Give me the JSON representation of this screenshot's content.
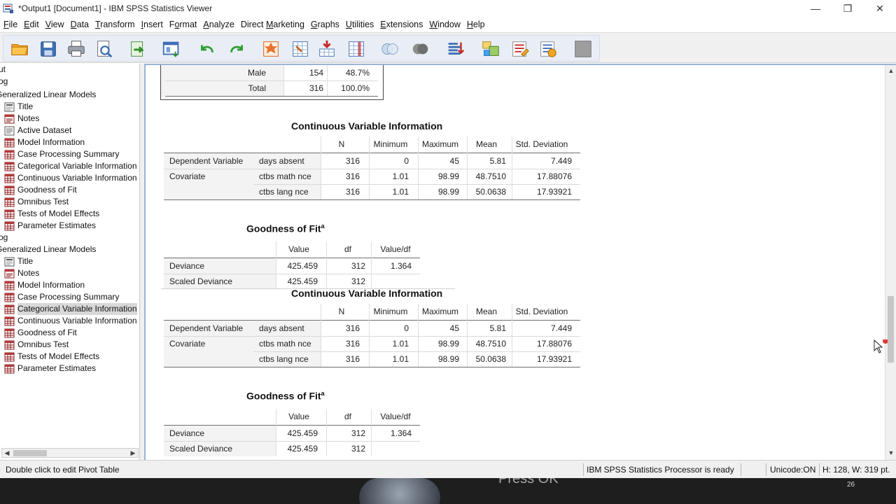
{
  "window": {
    "title": "*Output1 [Document1] - IBM SPSS Statistics Viewer",
    "minimize": "—",
    "restore": "❐",
    "close": "✕"
  },
  "menu": [
    {
      "label": "File",
      "u": "F",
      "rest": "ile"
    },
    {
      "label": "Edit",
      "u": "E",
      "rest": "dit"
    },
    {
      "label": "View",
      "u": "V",
      "rest": "iew"
    },
    {
      "label": "Data",
      "u": "D",
      "rest": "ata"
    },
    {
      "label": "Transform",
      "u": "T",
      "rest": "ransform"
    },
    {
      "label": "Insert",
      "u": "I",
      "rest": "nsert"
    },
    {
      "label": "Format",
      "pre": "F",
      "u": "o",
      "rest": "rmat"
    },
    {
      "label": "Analyze",
      "u": "A",
      "rest": "nalyze"
    },
    {
      "label": "Direct Marketing",
      "pre": "Direct ",
      "u": "M",
      "rest": "arketing"
    },
    {
      "label": "Graphs",
      "u": "G",
      "rest": "raphs"
    },
    {
      "label": "Utilities",
      "u": "U",
      "rest": "tilities"
    },
    {
      "label": "Extensions",
      "u": "E",
      "rest": "xtensions"
    },
    {
      "label": "Window",
      "u": "W",
      "rest": "indow"
    },
    {
      "label": "Help",
      "u": "H",
      "rest": "elp"
    }
  ],
  "toolbar_icons": [
    "open-folder-icon",
    "save-icon",
    "print-icon",
    "print-preview-icon",
    "export-icon",
    "recall-dialog-icon",
    "undo-icon",
    "redo-icon",
    "goto-case-icon",
    "goto-variable-icon",
    "insert-cases-icon",
    "insert-variable-icon",
    "split-file-icon",
    "select-cases-icon",
    "weight-cases-icon",
    "value-labels-icon",
    "use-sets-icon",
    "show-variables-icon",
    "spell-check-icon",
    "disabled-icon"
  ],
  "outline": [
    {
      "label": "ut",
      "icon": ""
    },
    {
      "label": "og",
      "icon": ""
    },
    {
      "label": "Generalized Linear Models",
      "icon": ""
    },
    {
      "label": "Title",
      "icon": "title-icon"
    },
    {
      "label": "Notes",
      "icon": "notes-icon"
    },
    {
      "label": "Active Dataset",
      "icon": "log-icon"
    },
    {
      "label": "Model Information",
      "icon": "table-icon"
    },
    {
      "label": "Case Processing Summary",
      "icon": "table-icon"
    },
    {
      "label": "Categorical Variable Information",
      "icon": "table-icon"
    },
    {
      "label": "Continuous Variable Information",
      "icon": "table-icon"
    },
    {
      "label": "Goodness of Fit",
      "icon": "table-icon"
    },
    {
      "label": "Omnibus Test",
      "icon": "table-icon"
    },
    {
      "label": "Tests of Model Effects",
      "icon": "table-icon"
    },
    {
      "label": "Parameter Estimates",
      "icon": "table-icon"
    },
    {
      "label": "og",
      "icon": ""
    },
    {
      "label": "Generalized Linear Models",
      "icon": ""
    },
    {
      "label": "Title",
      "icon": "title-icon"
    },
    {
      "label": "Notes",
      "icon": "notes-icon"
    },
    {
      "label": "Model Information",
      "icon": "table-icon"
    },
    {
      "label": "Case Processing Summary",
      "icon": "table-icon"
    },
    {
      "label": "Categorical Variable Information",
      "icon": "table-icon",
      "selected": true
    },
    {
      "label": "Continuous Variable Information",
      "icon": "table-icon"
    },
    {
      "label": "Goodness of Fit",
      "icon": "table-icon"
    },
    {
      "label": "Omnibus Test",
      "icon": "table-icon"
    },
    {
      "label": "Tests of Model Effects",
      "icon": "table-icon"
    },
    {
      "label": "Parameter Estimates",
      "icon": "table-icon"
    }
  ],
  "partial_table": {
    "rows": [
      {
        "label": "Male",
        "n": "154",
        "pct": "48.7%"
      },
      {
        "label": "Total",
        "n": "316",
        "pct": "100.0%"
      }
    ]
  },
  "continuous_table": {
    "title": "Continuous Variable Information",
    "headers": [
      "N",
      "Minimum",
      "Maximum",
      "Mean",
      "Std. Deviation"
    ],
    "rows": [
      {
        "group": "Dependent Variable",
        "var": "days absent",
        "vals": [
          "316",
          "0",
          "45",
          "5.81",
          "7.449"
        ]
      },
      {
        "group": "Covariate",
        "var": "ctbs math nce",
        "vals": [
          "316",
          "1.01",
          "98.99",
          "48.7510",
          "17.88076"
        ]
      },
      {
        "group": "",
        "var": "ctbs lang nce",
        "vals": [
          "316",
          "1.01",
          "98.99",
          "50.0638",
          "17.93921"
        ]
      }
    ]
  },
  "goodness_table": {
    "title": "Goodness of Fit",
    "footnote_mark": "a",
    "headers": [
      "Value",
      "df",
      "Value/df"
    ],
    "rows": [
      {
        "label": "Deviance",
        "vals": [
          "425.459",
          "312",
          "1.364"
        ]
      },
      {
        "label": "Scaled Deviance",
        "vals": [
          "425.459",
          "312",
          ""
        ]
      }
    ]
  },
  "status": {
    "left": "Double click to edit Pivot Table",
    "processor": "IBM SPSS Statistics Processor is ready",
    "unicode": "Unicode:ON",
    "size": "H: 128, W: 319 pt."
  },
  "taskbar": {
    "ghost_text": "Press OK",
    "page_number": "26"
  },
  "colors": {
    "viewer_border": "#9ab4d8",
    "toolbar_bg": "#e9eef6",
    "selected_item": "#d8d8d8",
    "cursor_dot": "#e53935"
  }
}
